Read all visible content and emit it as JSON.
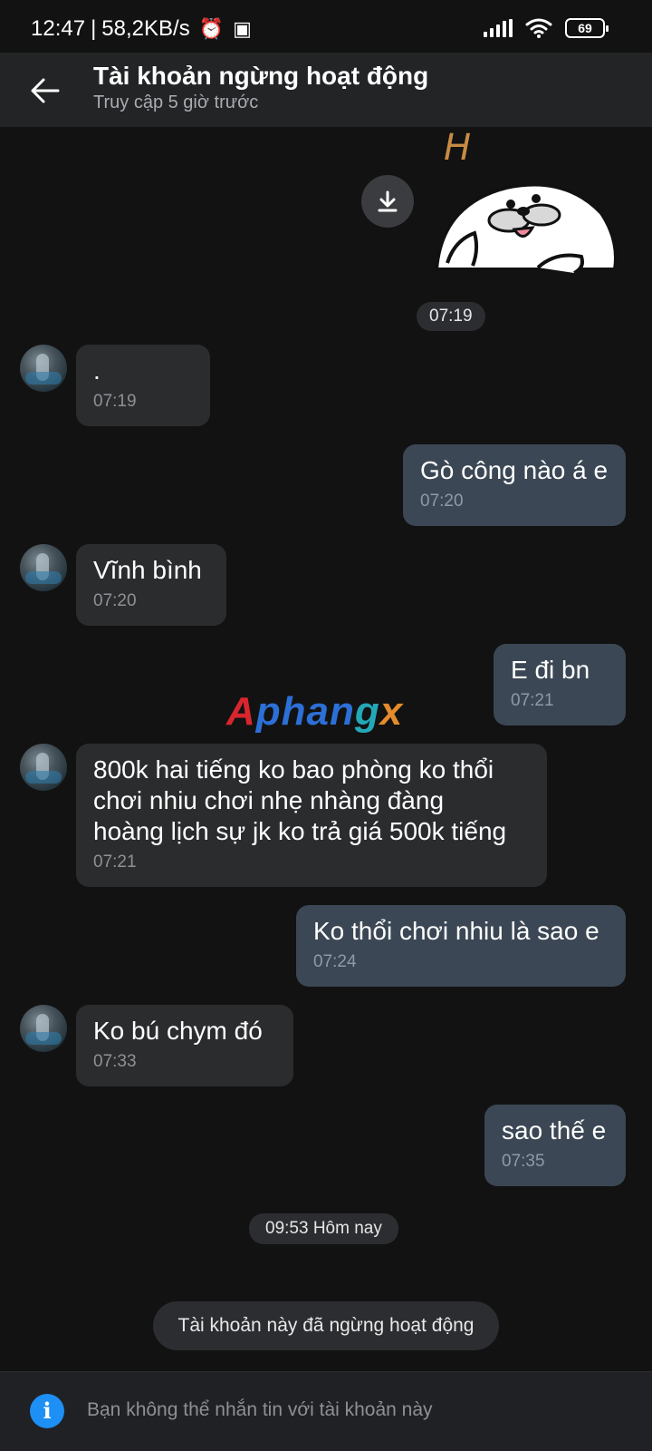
{
  "status_bar": {
    "time": "12:47",
    "network_speed": "58,2KB/s",
    "battery": "69",
    "icons": [
      "alarm-icon",
      "app-icon",
      "signal-icon",
      "wifi-icon",
      "battery-icon"
    ]
  },
  "header": {
    "title": "Tài khoản ngừng hoạt động",
    "subtitle": "Truy cập 5 giờ trước"
  },
  "sticker_letter": "H",
  "messages": [
    {
      "dir": "time",
      "text": "07:19"
    },
    {
      "dir": "in",
      "text": ".",
      "time": "07:19"
    },
    {
      "dir": "out",
      "text": "Gò công nào á e",
      "time": "07:20"
    },
    {
      "dir": "in",
      "text": "Vĩnh bình",
      "time": "07:20"
    },
    {
      "dir": "out",
      "text": "E đi bn",
      "time": "07:21"
    },
    {
      "dir": "in",
      "text": "800k hai tiếng ko bao phòng ko thổi\nchơi nhiu chơi nhẹ nhàng đàng\nhoàng lịch sự jk ko trả giá 500k tiếng",
      "time": "07:21"
    },
    {
      "dir": "out",
      "text": "Ko thổi chơi nhiu là sao e",
      "time": "07:24"
    },
    {
      "dir": "in",
      "text": "Ko bú chym đó",
      "time": "07:33"
    },
    {
      "dir": "out",
      "text": "sao thế e",
      "time": "07:35"
    }
  ],
  "watermark": "Aphangx",
  "date_separator": "09:53 Hôm nay",
  "system_notice": "Tài khoản này đã ngừng hoạt động",
  "footer": {
    "text": "Bạn không thể nhắn tin với tài khoản này"
  },
  "colors": {
    "background": "#121212",
    "header": "#222426",
    "bubble_in": "#2b2c2e",
    "bubble_out": "#3b4754",
    "info_blue": "#1e8ff5"
  }
}
